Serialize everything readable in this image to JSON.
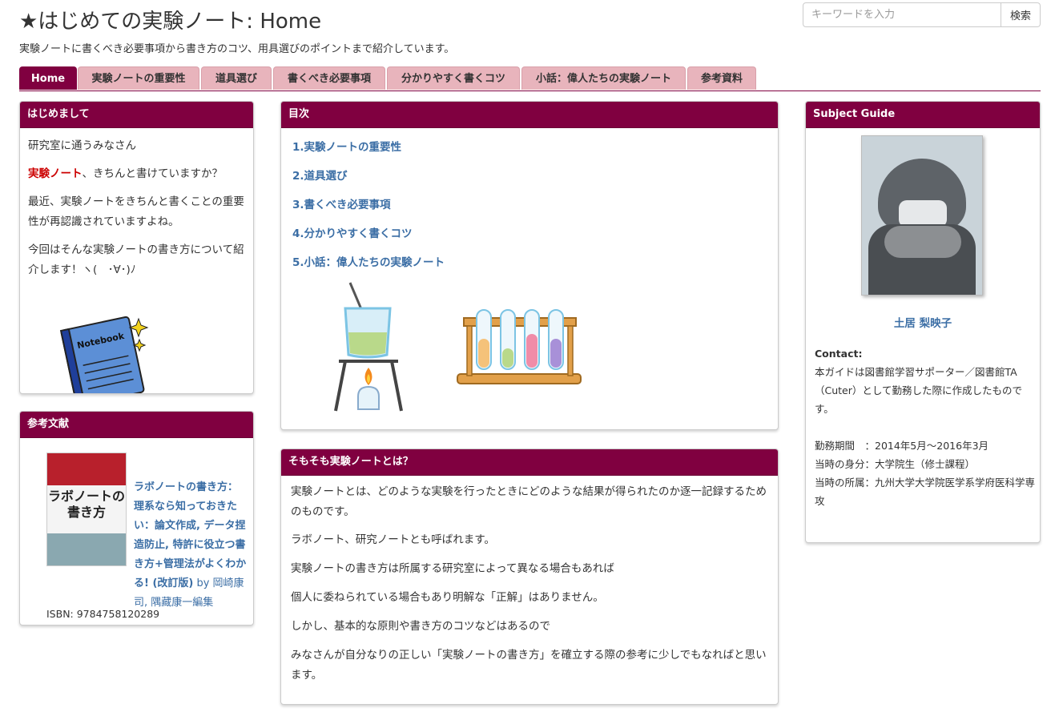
{
  "header": {
    "title": "★はじめての実験ノート: Home",
    "subtitle": "実験ノートに書くべき必要事項から書き方のコツ、用具選びのポイントまで紹介しています。"
  },
  "search": {
    "placeholder": "キーワードを入力",
    "button": "検索"
  },
  "tabs": [
    {
      "label": "Home",
      "active": true
    },
    {
      "label": "実験ノートの重要性"
    },
    {
      "label": "道具選び"
    },
    {
      "label": "書くべき必要事項"
    },
    {
      "label": "分かりやすく書くコツ"
    },
    {
      "label": "小話：偉人たちの実験ノート"
    },
    {
      "label": "参考資料"
    }
  ],
  "intro": {
    "heading": "はじめまして",
    "line1": "研究室に通うみなさん",
    "highlight": "実験ノート",
    "line2_rest": "、きちんと書けていますか？",
    "line3": "最近、実験ノートをきちんと書くことの重要性が再認識されていますよね。",
    "line4": "今回はそんな実験ノートの書き方について紹介します！ヽ(　･∀･)ﾉ",
    "notebook_label": "Notebook"
  },
  "references": {
    "heading": "参考文献",
    "book_title": "ラボノートの書き方：理系なら知っておきたい：論文作成, データ捏造防止, 特許に役立つ書き方+管理法がよくわかる! (改訂版)",
    "by": "by 岡崎康司, 隅藏康一編集",
    "isbn": "ISBN: 9784758120289",
    "cover_text": "ラボノートの書き方"
  },
  "toc": {
    "heading": "目次",
    "items": [
      "1.実験ノートの重要性",
      "2.道具選び",
      "3.書くべき必要事項",
      "4.分かりやすく書くコツ",
      "5.小話：偉人たちの実験ノート"
    ]
  },
  "about": {
    "heading": "そもそも実験ノートとは？",
    "paragraphs": [
      "実験ノートとは、どのような実験を行ったときにどのような結果が得られたのか逐一記録するためのものです。",
      "ラボノート、研究ノートとも呼ばれます。",
      "実験ノートの書き方は所属する研究室によって異なる場合もあれば",
      "個人に委ねられている場合もあり明解な「正解」はありません。",
      "しかし、基本的な原則や書き方のコツなどはあるので",
      "みなさんが自分なりの正しい「実験ノートの書き方」を確立する際の参考に少しでもなればと思います。"
    ]
  },
  "guide": {
    "heading": "Subject Guide",
    "name": "土居 梨映子",
    "contact_label": "Contact:",
    "contact_text": "本ガイドは図書館学習サポーター／図書館TA（Cuter）として勤務した際に作成したものです。",
    "period": "勤務期間　：2014年5月～2016年3月",
    "status": "当時の身分：大学院生（修士課程）",
    "affiliation": "当時の所属：九州大学大学院医学系学府医科学専攻"
  },
  "colors": {
    "brand": "#800040",
    "tab": "#e8b4bc",
    "link": "#3b6ea5"
  }
}
